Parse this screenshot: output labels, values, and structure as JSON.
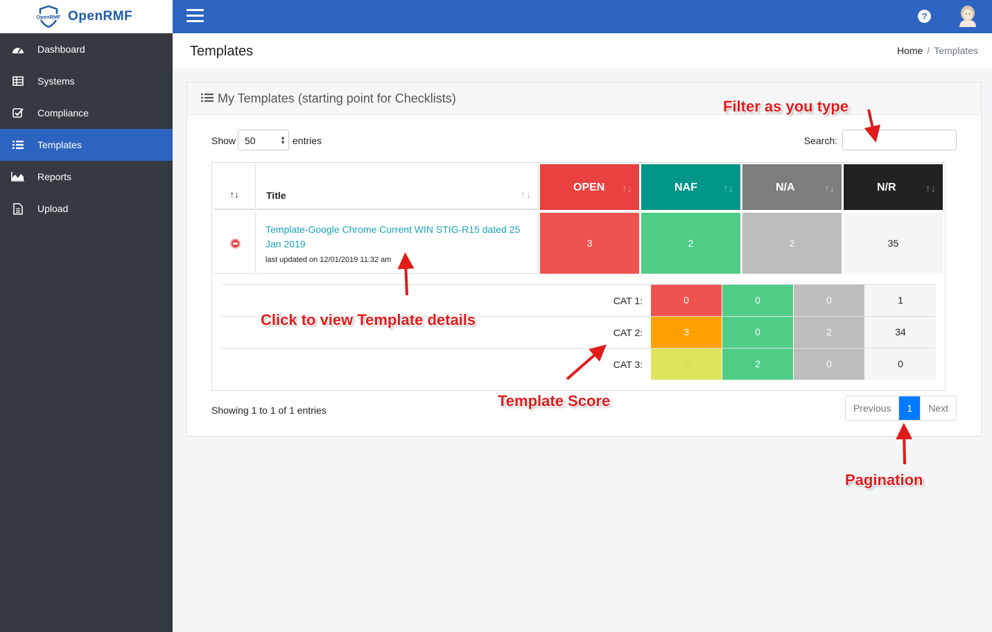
{
  "brand": {
    "logo_text": "OpenRMF",
    "name": "OpenRMF"
  },
  "sidebar": {
    "items": [
      {
        "label": "Dashboard",
        "icon": "dashboard-icon",
        "active": false
      },
      {
        "label": "Systems",
        "icon": "table-icon",
        "active": false
      },
      {
        "label": "Compliance",
        "icon": "check-square-icon",
        "active": false
      },
      {
        "label": "Templates",
        "icon": "list-icon",
        "active": true
      },
      {
        "label": "Reports",
        "icon": "area-chart-icon",
        "active": false
      },
      {
        "label": "Upload",
        "icon": "file-icon",
        "active": false
      }
    ]
  },
  "topbar": {
    "help_glyph": "?"
  },
  "header": {
    "title": "Templates",
    "breadcrumb": {
      "home": "Home",
      "separator": "/",
      "current": "Templates"
    }
  },
  "card": {
    "title": "My Templates (starting point for Checklists)",
    "show_label": "Show",
    "entries_select": "50",
    "entries_label": "entries",
    "search_label": "Search:",
    "search_value": ""
  },
  "table": {
    "sort_glyph": "↑↓",
    "title_header": "Title",
    "status_headers": [
      {
        "label": "OPEN",
        "color": "#e8413f"
      },
      {
        "label": "NAF",
        "color": "#009688"
      },
      {
        "label": "N/A",
        "color": "#7d7d7d"
      },
      {
        "label": "N/R",
        "color": "#222222"
      }
    ],
    "row": {
      "title": "Template-Google Chrome Current WIN STIG-R15 dated 25 Jan 2019",
      "updated": "last updated on 12/01/2019 11:32 am",
      "counts": [
        {
          "value": "3",
          "color": "#ef5350"
        },
        {
          "value": "2",
          "color": "#4fcd87"
        },
        {
          "value": "2",
          "color": "#bdbdbd"
        },
        {
          "value": "35",
          "color": "#f5f5f5"
        }
      ]
    },
    "categories": [
      {
        "label": "CAT 1:",
        "values": [
          "0",
          "0",
          "0",
          "1"
        ],
        "colors": [
          "#ef5350",
          "#4fcd87",
          "#bdbdbd",
          "#f5f5f5"
        ]
      },
      {
        "label": "CAT 2:",
        "values": [
          "3",
          "0",
          "2",
          "34"
        ],
        "colors": [
          "#ffa000",
          "#4fcd87",
          "#bdbdbd",
          "#f5f5f5"
        ]
      },
      {
        "label": "CAT 3:",
        "values": [
          "0",
          "2",
          "0",
          "0"
        ],
        "colors": [
          "#dce55c",
          "#4fcd87",
          "#bdbdbd",
          "#f5f5f5"
        ]
      }
    ]
  },
  "footer": {
    "info": "Showing 1 to 1 of 1 entries",
    "pager": {
      "previous": "Previous",
      "current": "1",
      "next": "Next"
    }
  },
  "annotations": {
    "filter": "Filter as you type",
    "click": "Click to view Template details",
    "score": "Template Score",
    "pagination": "Pagination"
  }
}
